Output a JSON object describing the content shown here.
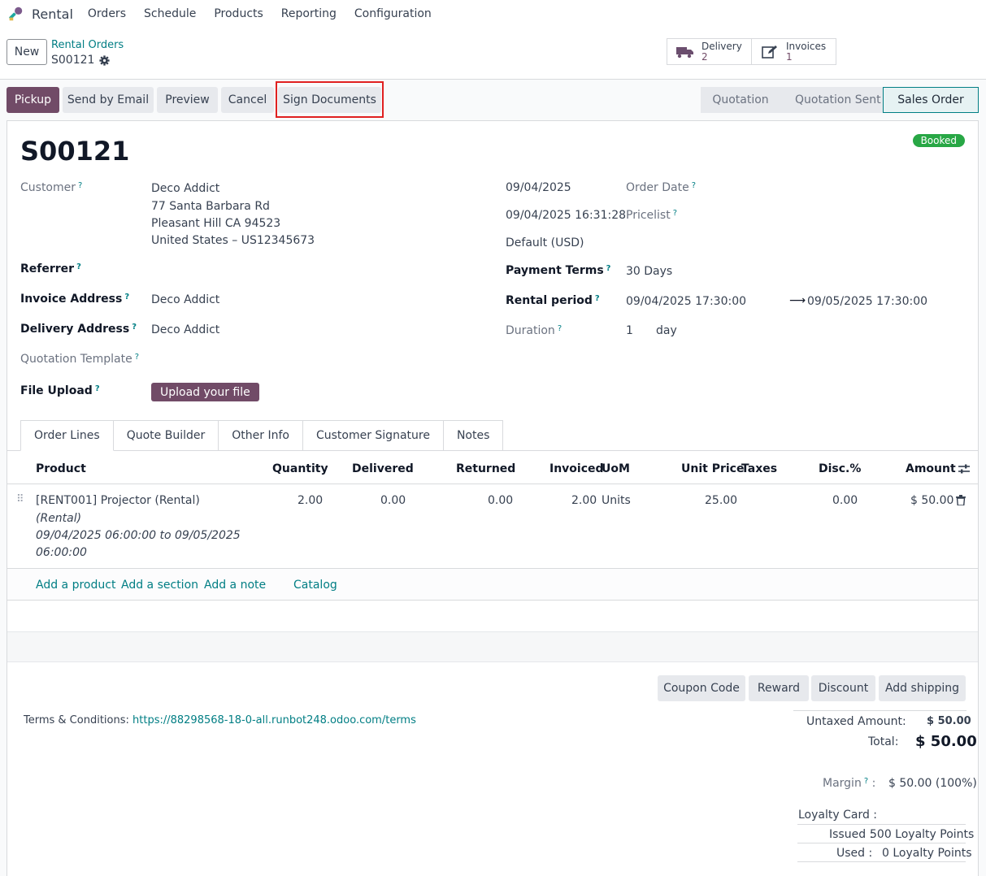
{
  "nav": {
    "app_name": "Rental",
    "menu": [
      "Orders",
      "Schedule",
      "Products",
      "Reporting",
      "Configuration"
    ]
  },
  "control": {
    "new_label": "New",
    "breadcrumb_parent": "Rental Orders",
    "breadcrumb_current": "S00121",
    "smart_buttons": [
      {
        "label": "Delivery",
        "count": "2",
        "icon": "truck-icon"
      },
      {
        "label": "Invoices",
        "count": "1",
        "icon": "edit-invoice-icon"
      }
    ]
  },
  "actions": {
    "pickup": "Pickup",
    "send_email": "Send by Email",
    "preview": "Preview",
    "cancel": "Cancel",
    "sign_documents": "Sign Documents"
  },
  "stages": {
    "quotation": "Quotation",
    "quotation_sent": "Quotation Sent",
    "sales_order": "Sales Order"
  },
  "form": {
    "name": "S00121",
    "status_badge": "Booked",
    "customer_label": "Customer",
    "customer_name": "Deco Addict",
    "customer_address_1": "77 Santa Barbara Rd",
    "customer_address_2": "Pleasant Hill CA 94523",
    "customer_address_3": "United States – US12345673",
    "referrer_label": "Referrer",
    "invoice_address_label": "Invoice Address",
    "invoice_address": "Deco Addict",
    "delivery_address_label": "Delivery Address",
    "delivery_address": "Deco Addict",
    "quotation_template_label": "Quotation Template",
    "file_upload_label": "File Upload",
    "upload_button": "Upload your file",
    "order_date_value": "09/04/2025",
    "order_date_label": "Order Date",
    "order_datetime_value": "09/04/2025 16:31:28",
    "pricelist_label": "Pricelist",
    "pricelist_value": "Default (USD)",
    "payment_terms_label": "Payment Terms",
    "payment_terms_value": "30 Days",
    "rental_period_label": "Rental period",
    "rental_start": "09/04/2025 17:30:00",
    "rental_end": "09/05/2025 17:30:00",
    "duration_label": "Duration",
    "duration_value": "1",
    "duration_unit": "day"
  },
  "tabs": [
    "Order Lines",
    "Quote Builder",
    "Other Info",
    "Customer Signature",
    "Notes"
  ],
  "table": {
    "headers": {
      "product": "Product",
      "quantity": "Quantity",
      "delivered": "Delivered",
      "returned": "Returned",
      "invoiced": "Invoiced",
      "uom": "UoM",
      "unit_price": "Unit Price",
      "taxes": "Taxes",
      "disc": "Disc.%",
      "amount": "Amount"
    },
    "row": {
      "product": "[RENT001] Projector (Rental)",
      "desc_1": "(Rental)",
      "desc_2": "09/04/2025 06:00:00 to 09/05/2025",
      "desc_3": "06:00:00",
      "quantity": "2.00",
      "delivered": "0.00",
      "returned": "0.00",
      "invoiced": "2.00",
      "uom": "Units",
      "unit_price": "25.00",
      "disc": "0.00",
      "amount": "$ 50.00"
    },
    "add_product": "Add a product",
    "add_section": "Add a section",
    "add_note": "Add a note",
    "catalog": "Catalog"
  },
  "footer_buttons": {
    "coupon": "Coupon Code",
    "reward": "Reward",
    "discount": "Discount",
    "shipping": "Add shipping"
  },
  "terms": {
    "label": "Terms & Conditions:",
    "link": "https://88298568-18-0-all.runbot248.odoo.com/terms"
  },
  "totals": {
    "untaxed_label": "Untaxed Amount:",
    "untaxed_value": "$ 50.00",
    "total_label": "Total:",
    "total_value": "$ 50.00",
    "margin_label": "Margin",
    "margin_value": "$ 50.00 (100%)",
    "loyalty_label": "Loyalty Card :",
    "issued_label": "Issued :",
    "issued_value": "500 Loyalty Points",
    "used_label": "Used :",
    "used_value": "0 Loyalty Points"
  },
  "colors": {
    "primary": "#714b67",
    "link": "#017e84",
    "badge": "#28a745"
  }
}
